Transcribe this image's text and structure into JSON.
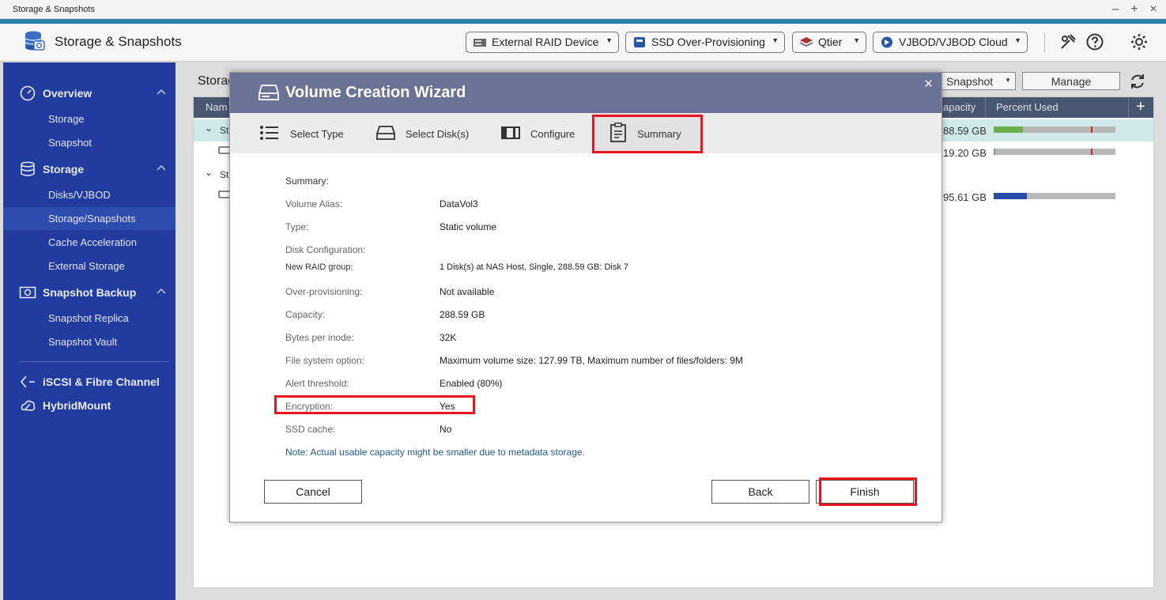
{
  "window": {
    "title": "Storage & Snapshots"
  },
  "header": {
    "app_title": "Storage & Snapshots",
    "dropdowns": [
      {
        "label": "External RAID Device",
        "icon": "external-raid-icon"
      },
      {
        "label": "SSD Over-Provisioning",
        "icon": "ssd-icon"
      },
      {
        "label": "Qtier",
        "icon": "qtier-icon"
      },
      {
        "label": "VJBOD/VJBOD Cloud",
        "icon": "vjbod-icon"
      }
    ]
  },
  "sidebar": {
    "sections": [
      {
        "label": "Overview",
        "icon": "gauge-icon",
        "items": [
          "Storage",
          "Snapshot"
        ]
      },
      {
        "label": "Storage",
        "icon": "database-icon",
        "items": [
          "Disks/VJBOD",
          "Storage/Snapshots",
          "Cache Acceleration",
          "External Storage"
        ]
      },
      {
        "label": "Snapshot Backup",
        "icon": "snapshot-backup-icon",
        "items": [
          "Snapshot Replica",
          "Snapshot Vault"
        ]
      }
    ],
    "extra": [
      {
        "label": "iSCSI & Fibre Channel",
        "icon": "iscsi-icon"
      },
      {
        "label": "HybridMount",
        "icon": "hybridmount-icon"
      }
    ],
    "active_item": "Storage/Snapshots"
  },
  "main": {
    "title_partial": "Storag",
    "toolbar": {
      "snapshot_label": "Snapshot",
      "manage_label": "Manage"
    },
    "columns": {
      "name": "Nam",
      "capacity": "apacity",
      "percent_used": "Percent Used"
    },
    "rows": [
      {
        "capacity": "88.59 GB",
        "used": 0.24,
        "threshold": 0.8,
        "bar_color": "#6ab04c"
      },
      {
        "capacity": "19.20 GB",
        "used": 0.01,
        "threshold": 0.8,
        "bar_color": "#6ab04c"
      },
      {
        "capacity": "95.61 GB",
        "used": 0.27,
        "threshold": null,
        "bar_color": "#2a4aa8"
      }
    ],
    "row_prefix": "St"
  },
  "wizard": {
    "title": "Volume Creation Wizard",
    "steps": [
      {
        "label": "Select Type",
        "icon": "list-icon"
      },
      {
        "label": "Select Disk(s)",
        "icon": "disk-icon"
      },
      {
        "label": "Configure",
        "icon": "configure-icon"
      },
      {
        "label": "Summary",
        "icon": "clipboard-icon"
      }
    ],
    "current_step": "Summary",
    "summary_heading": "Summary:",
    "summary": [
      {
        "key": "Volume Alias:",
        "value": "DataVol3"
      },
      {
        "key": "Type:",
        "value": "Static volume"
      },
      {
        "key": "Disk Configuration:",
        "value": ""
      },
      {
        "key": "New RAID group:",
        "value": "1 Disk(s) at NAS Host, Single, 288.59 GB: Disk 7"
      },
      {
        "key": "Over-provisioning:",
        "value": "Not available"
      },
      {
        "key": "Capacity:",
        "value": "288.59 GB"
      },
      {
        "key": "Bytes per inode:",
        "value": "32K"
      },
      {
        "key": "File system option:",
        "value": "Maximum volume size: 127.99 TB, Maximum number of files/folders: 9M"
      },
      {
        "key": "Alert threshold:",
        "value": "Enabled (80%)"
      },
      {
        "key": "Encryption:",
        "value": "Yes"
      },
      {
        "key": "SSD cache:",
        "value": "No"
      }
    ],
    "note": "Note: Actual usable capacity might be smaller due to metadata storage.",
    "buttons": {
      "cancel": "Cancel",
      "back": "Back",
      "finish": "Finish"
    },
    "highlight_color": "#e8141f"
  }
}
